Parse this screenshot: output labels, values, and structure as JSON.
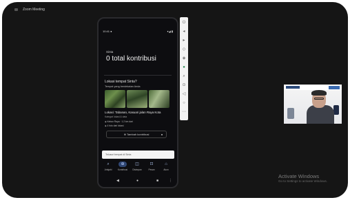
{
  "top_label": "Zoom Meeting",
  "phone": {
    "status_time": "10:41 ●",
    "status_signal": "▾◢ ▮",
    "app_small": "Sinta",
    "total_title": "0 total kontribusi",
    "section_title": "Lokasi tempat Sinta?",
    "section_sub": "Tempat yang berdekatan Anda",
    "card_title": "Lokasi: Tabanan, Kasuari jalan Raya Kota",
    "card_sub": "Kategori lokasi & data",
    "row1": "◈ Kebun Raya · 1.2 km dari",
    "row2": "◈ 4 foto dari lokasi",
    "contrib_button": "⊕ Tambah kontribusi",
    "search_placeholder": "Telusuri tempat di Sinta",
    "nav": [
      {
        "icon": "⌕",
        "label": "Jelajahi"
      },
      {
        "icon": "⊕",
        "label": "Kontribusi"
      },
      {
        "icon": "◫",
        "label": "Disimpan"
      },
      {
        "icon": "⊡",
        "label": "Pesan"
      },
      {
        "icon": "⌂",
        "label": "Akun"
      }
    ],
    "sysnav": [
      "◀",
      "●",
      "■",
      "⋮"
    ]
  },
  "toolbar_icons": [
    "⏻",
    "◂",
    "▸",
    "◇",
    "◈",
    "●",
    "⌕",
    "⊙",
    "◁",
    "○",
    "⋯"
  ],
  "watermark": {
    "line1": "Activate Windows",
    "line2": "Go to Settings to activate Windows."
  }
}
